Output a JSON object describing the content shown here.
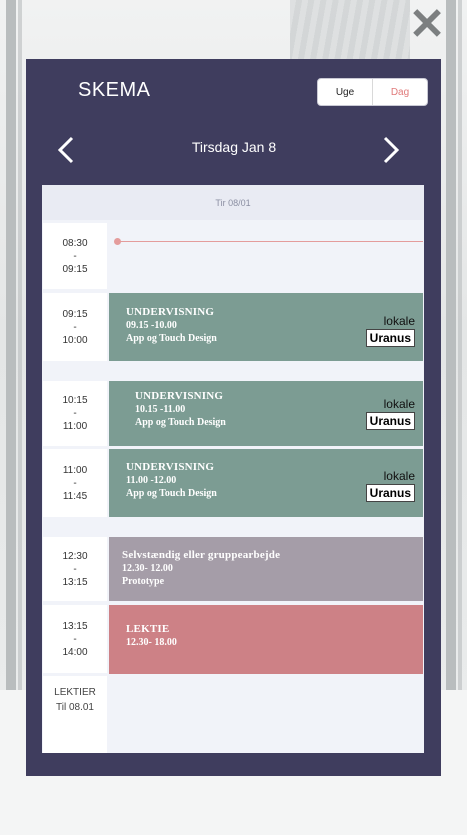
{
  "header": {
    "title": "SKEMA",
    "close": "✕"
  },
  "view_toggle": {
    "week": "Uge",
    "day": "Dag",
    "active": "Dag"
  },
  "date_nav": {
    "title": "Tirsdag Jan 8"
  },
  "calendar": {
    "day_header": "Tir 08/01",
    "slots": [
      {
        "start": "08:30",
        "dash": "-",
        "end": "09:15"
      },
      {
        "start": "09:15",
        "dash": "-",
        "end": "10:00"
      },
      {
        "start": "10:15",
        "dash": "-",
        "end": "11:00"
      },
      {
        "start": "11:00",
        "dash": "-",
        "end": "11:45"
      },
      {
        "start": "12:30",
        "dash": "-",
        "end": "13:15"
      },
      {
        "start": "13:15",
        "dash": "-",
        "end": "14:00"
      }
    ],
    "events": [
      {
        "title": "UNDERVISNING",
        "time": "09.15 -10.00",
        "desc": "App og Touch Design",
        "lokale_label": "lokale",
        "room": "Uranus"
      },
      {
        "title": "UNDERVISNING",
        "time": "10.15 -11.00",
        "desc": "App og Touch Design",
        "lokale_label": "lokale",
        "room": "Uranus"
      },
      {
        "title": "UNDERVISNING",
        "time": "11.00 -12.00",
        "desc": "App og Touch Design",
        "lokale_label": "lokale",
        "room": "Uranus"
      },
      {
        "title": "Selvstændig eller gruppearbejde",
        "time": "12.30- 12.00",
        "desc": "Prototype"
      },
      {
        "title": "LEKTIE",
        "time": "12.30- 18.00"
      }
    ],
    "homework": {
      "label": "LEKTIER",
      "until": "Til 08.01"
    }
  },
  "colors": {
    "modal": "#3f3d5e",
    "teaching": "#7c9c93",
    "group_work": "#a59da8",
    "homework": "#cd8186",
    "now_line": "#e49c9c"
  }
}
